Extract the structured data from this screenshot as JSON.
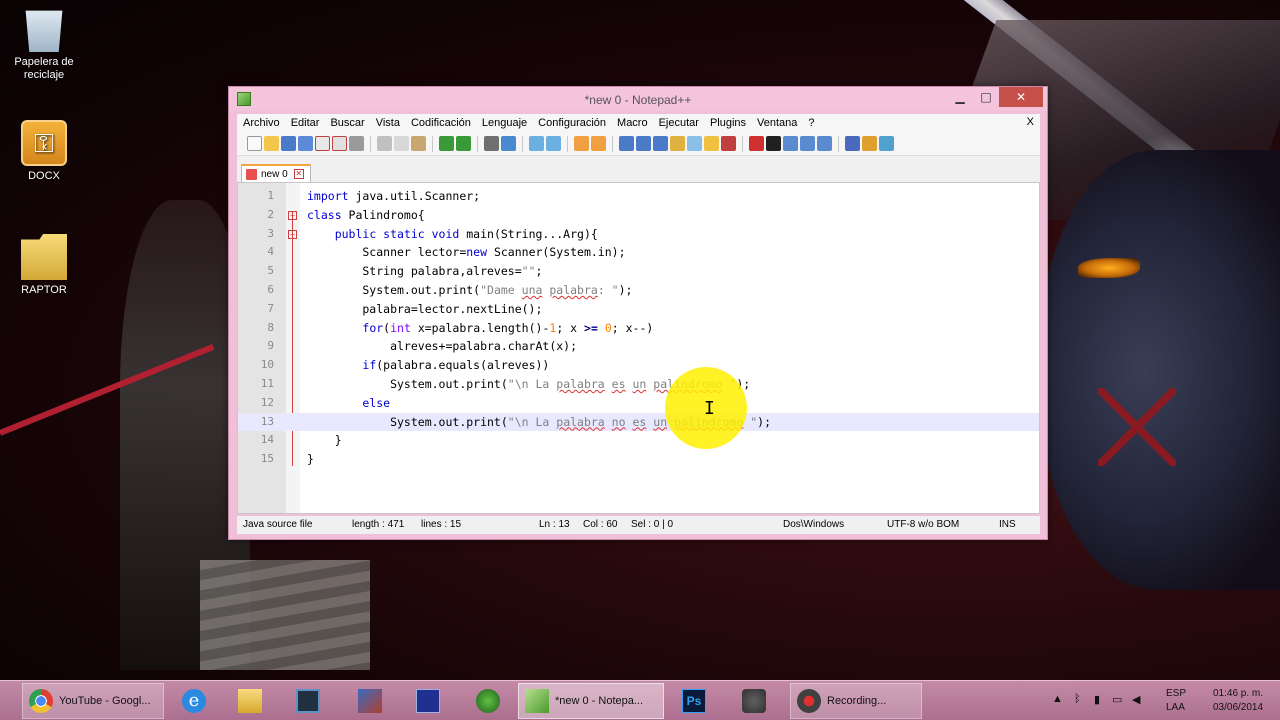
{
  "desktop": {
    "icons": [
      {
        "label": "Papelera de\nreciclaje",
        "label_line1": "Papelera de",
        "label_line2": "reciclaje"
      },
      {
        "label": "DOCX"
      },
      {
        "label": "RAPTOR"
      }
    ]
  },
  "window": {
    "title": "*new  0 - Notepad++",
    "controls": {
      "minimize": "▁",
      "maximize": "□",
      "close": "✕"
    },
    "menu": [
      "Archivo",
      "Editar",
      "Buscar",
      "Vista",
      "Codificación",
      "Lenguaje",
      "Configuración",
      "Macro",
      "Ejecutar",
      "Plugins",
      "Ventana",
      "?"
    ],
    "menu_close": "X",
    "tab": {
      "label": "new  0"
    },
    "code_lines": [
      {
        "n": "1",
        "text": "import java.util.Scanner;"
      },
      {
        "n": "2",
        "text": "class Palindromo{"
      },
      {
        "n": "3",
        "text": "    public static void main(String...Arg){"
      },
      {
        "n": "4",
        "text": "        Scanner lector=new Scanner(System.in);"
      },
      {
        "n": "5",
        "text": "        String palabra,alreves=\"\";"
      },
      {
        "n": "6",
        "text": "        System.out.print(\"Dame una palabra: \");"
      },
      {
        "n": "7",
        "text": "        palabra=lector.nextLine();"
      },
      {
        "n": "8",
        "text": "        for(int x=palabra.length()-1; x >= 0; x--)"
      },
      {
        "n": "9",
        "text": "            alreves+=palabra.charAt(x);"
      },
      {
        "n": "10",
        "text": "        if(palabra.equals(alreves))"
      },
      {
        "n": "11",
        "text": "            System.out.print(\"\\n La palabra es un palindromo \");"
      },
      {
        "n": "12",
        "text": "        else"
      },
      {
        "n": "13",
        "text": "            System.out.print(\"\\n La palabra no es un palindromo \");"
      },
      {
        "n": "14",
        "text": "    }"
      },
      {
        "n": "15",
        "text": "}"
      }
    ],
    "status": {
      "file_type": "Java source file",
      "length": "length : 471",
      "lines": "lines : 15",
      "ln": "Ln : 13",
      "col": "Col : 60",
      "sel": "Sel : 0 | 0",
      "eol": "Dos\\Windows",
      "encoding": "UTF-8 w/o BOM",
      "mode": "INS"
    }
  },
  "taskbar": {
    "items": [
      {
        "label": "YouTube - Googl..."
      },
      {
        "label": ""
      },
      {
        "label": ""
      },
      {
        "label": ""
      },
      {
        "label": ""
      },
      {
        "label": ""
      },
      {
        "label": ""
      },
      {
        "label": "*new  0 - Notepa..."
      },
      {
        "label": ""
      },
      {
        "label": ""
      },
      {
        "label": "Recording..."
      }
    ],
    "tray": {
      "lang_top": "ESP",
      "lang_bottom": "LAA",
      "time": "01:46 p. m.",
      "date": "03/06/2014"
    }
  },
  "colors": {
    "titlebar": "#f4c4dc",
    "close_button": "#c7504a",
    "keyword": "#0000d0",
    "type": "#8000ff",
    "string": "#808080",
    "number": "#ff8000",
    "current_line": "#e8e8ff",
    "cursor_highlight": "#fff000"
  }
}
